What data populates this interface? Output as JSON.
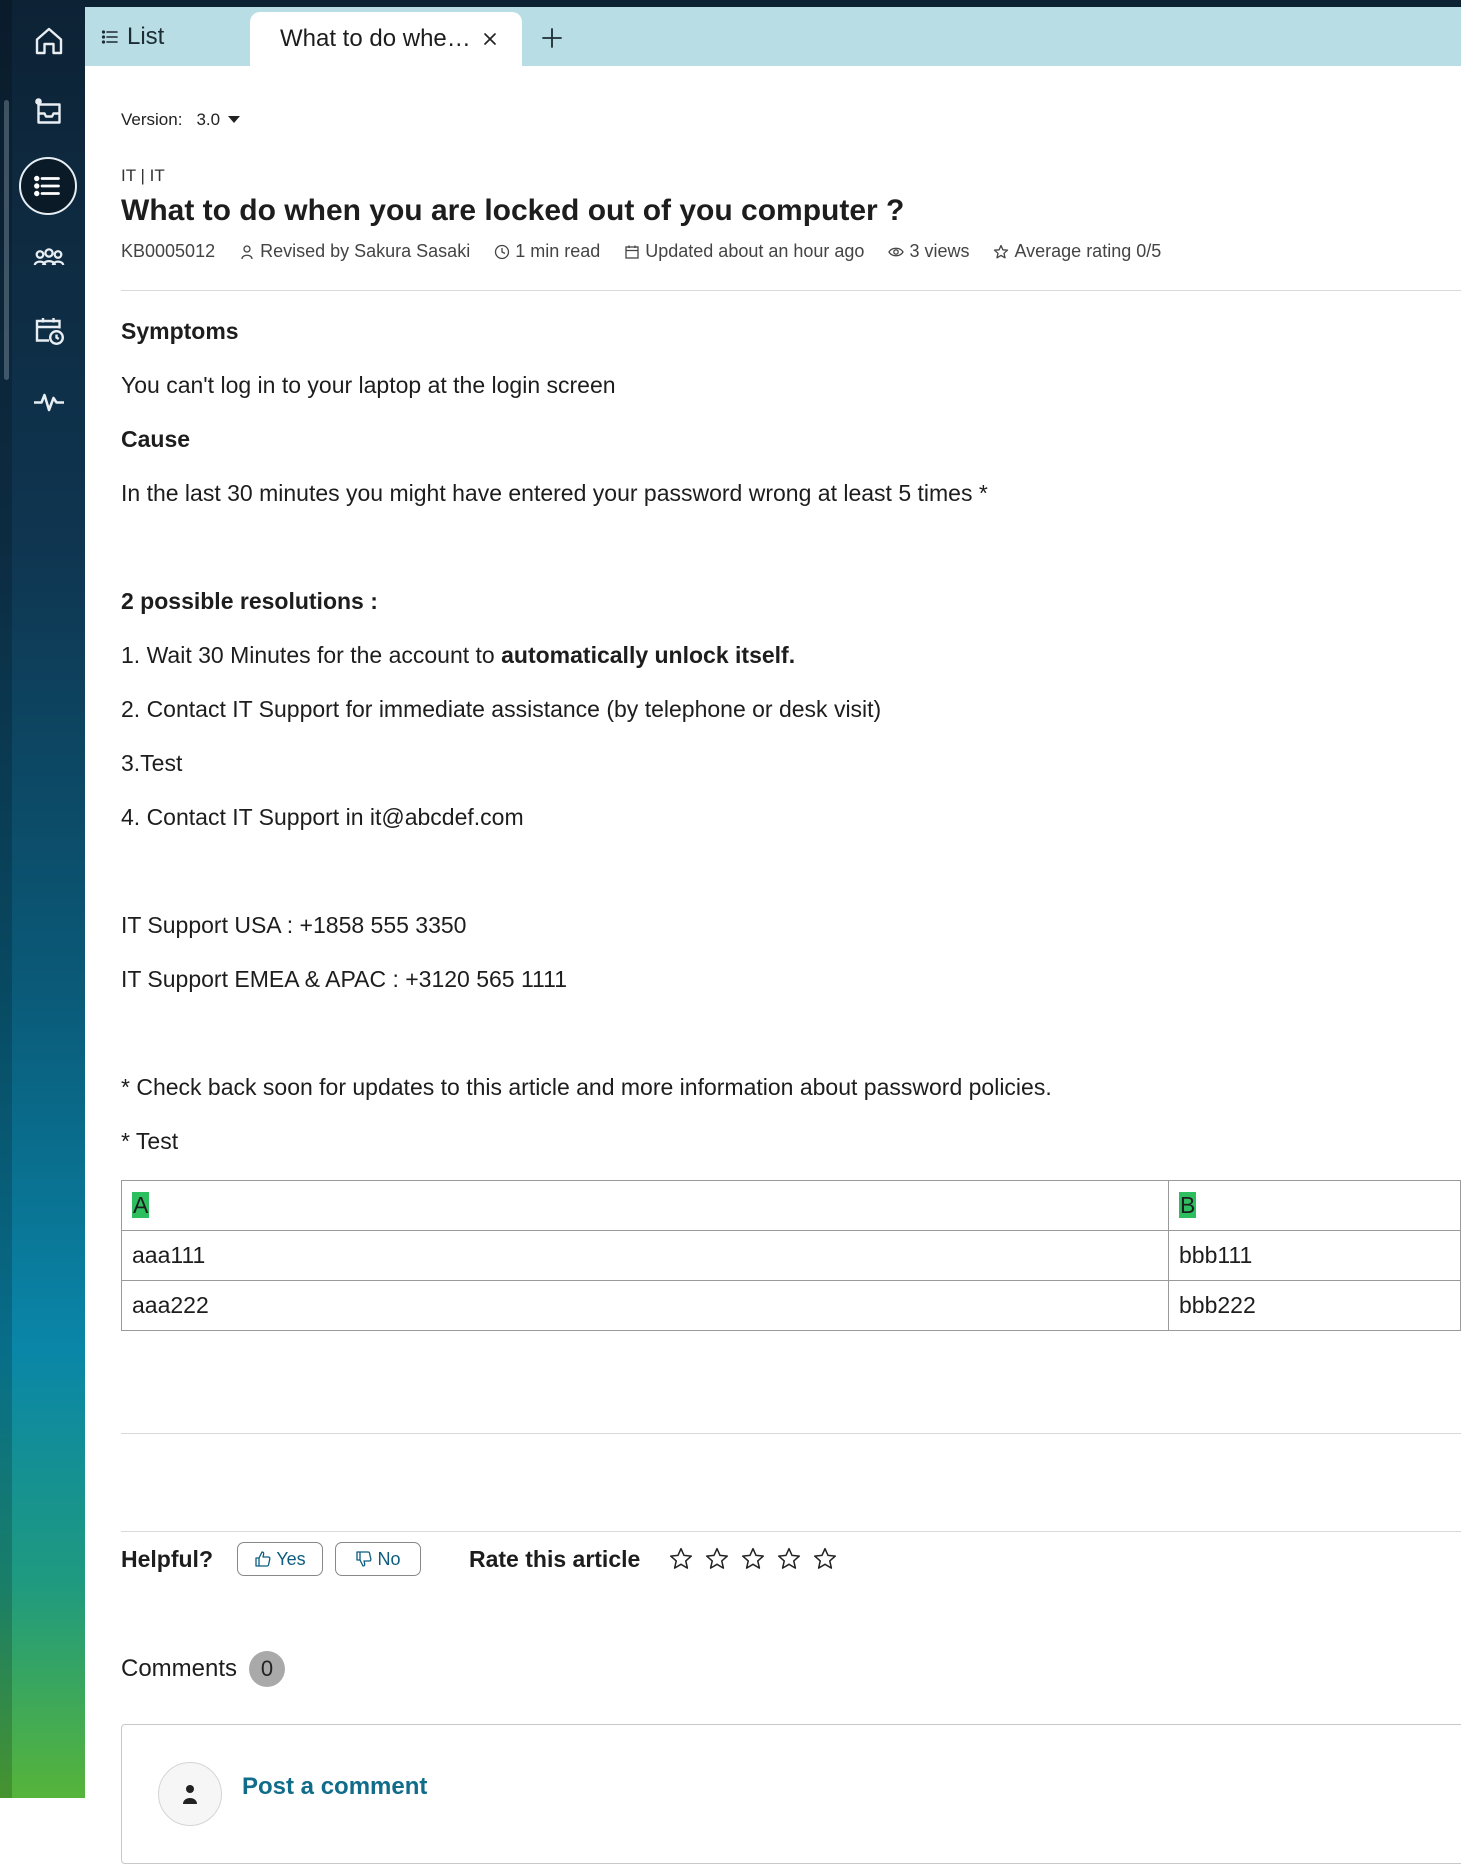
{
  "tabs": {
    "list_label": "List",
    "active_title": "What to do whe…"
  },
  "version": {
    "label": "Version:",
    "value": "3.0"
  },
  "article": {
    "breadcrumb": "IT | IT",
    "title": "What to do when you are locked out of you computer ?",
    "meta": {
      "id": "KB0005012",
      "revised_by": "Revised by Sakura Sasaki",
      "read_time": "1 min read",
      "updated": "Updated about an hour ago",
      "views": "3 views",
      "rating": "Average rating 0/5"
    },
    "symptoms_heading": "Symptoms",
    "symptoms_text": "You can't log in to your laptop at the login screen",
    "cause_heading": "Cause",
    "cause_text": "In the last 30 minutes you might have entered your password wrong at least 5 times *",
    "resolutions_heading": "2 possible resolutions :",
    "step1_text": "1. Wait 30 Minutes for the account to ",
    "step1_bold": "automatically unlock itself.",
    "step2": "2. Contact IT Support for immediate assistance (by telephone or desk visit)",
    "step3": "3.Test",
    "step4": "4. Contact IT Support in it@abcdef.com",
    "support_usa": "IT Support USA : +1858 555 3350",
    "support_emea": "IT Support EMEA & APAC : +3120 565 1111",
    "footnote1": "* Check back soon for updates to this article and more information about password policies.",
    "footnote2": "* Test",
    "table": {
      "headers": [
        "A",
        "B"
      ],
      "rows": [
        [
          "aaa111",
          "bbb111"
        ],
        [
          "aaa222",
          "bbb222"
        ]
      ]
    }
  },
  "feedback": {
    "helpful_label": "Helpful?",
    "yes_label": "Yes",
    "no_label": "No",
    "rate_label": "Rate this article",
    "star_count": 5
  },
  "comments": {
    "label": "Comments",
    "count": "0",
    "post_label": "Post a comment"
  },
  "colors": {
    "tab_bar": "#b8dde5",
    "link": "#116c8a",
    "highlight": "#2dbe60"
  },
  "icons": {
    "sidebar": [
      "home-icon",
      "inbox-icon",
      "list-icon",
      "groups-icon",
      "calendar-clock-icon",
      "activity-icon"
    ]
  }
}
